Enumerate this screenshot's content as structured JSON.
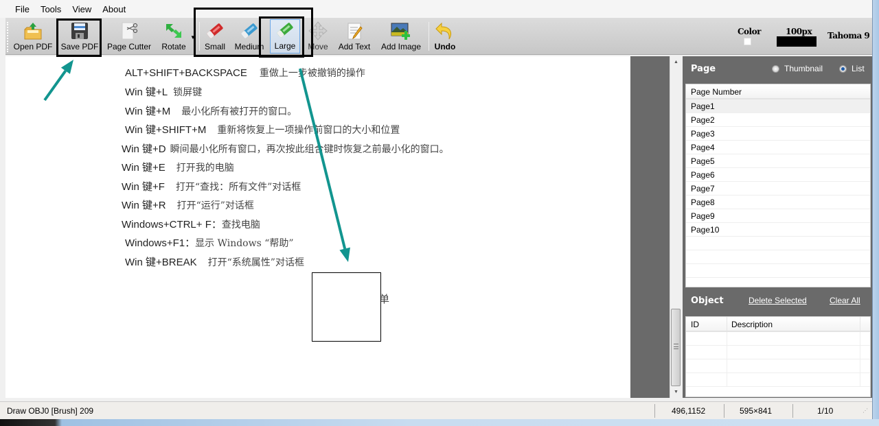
{
  "menu": [
    "File",
    "Tools",
    "View",
    "About"
  ],
  "toolbar": {
    "open_pdf": "Open PDF",
    "save_pdf": "Save PDF",
    "page_cutter": "Page Cutter",
    "rotate": "Rotate",
    "small": "Small",
    "medium": "Medium",
    "large": "Large",
    "move": "Move",
    "add_text": "Add Text",
    "add_image": "Add Image",
    "undo": "Undo",
    "color_label": "Color",
    "color_value": "#ffffff",
    "brush_size_label": "100px",
    "font_label": "Tahoma 9",
    "active_tool": "Large"
  },
  "document": {
    "lines": [
      {
        "key": "ALT+SHIFT+BACKSPACE",
        "desc": "重做上一步被撤销的操作"
      },
      {
        "key": "Win 键+L",
        "desc": "锁屏键"
      },
      {
        "key": "Win 键+M",
        "desc": "最小化所有被打开的窗口。"
      },
      {
        "key": "Win 键+SHIFT+M",
        "desc": "重新将恢复上一项操作前窗口的大小和位置"
      },
      {
        "key": "Win 键+D",
        "desc": "瞬间最小化所有窗口，再次按此组合键时恢复之前最小化的窗口。"
      },
      {
        "key": "Win 键+E",
        "desc": "打开我的电脑"
      },
      {
        "key": "Win 键+F",
        "desc": "打开“查找：所有文件”对话框"
      },
      {
        "key": "Win 键+R",
        "desc": "打开“运行”对话框"
      },
      {
        "key": "Windows+CTRL+ F：",
        "desc": "查找电脑"
      },
      {
        "key": "Windows+F1：",
        "desc": "显示  Windows “帮助”"
      },
      {
        "key": "Win 键+BREAK",
        "desc": "打开“系统属性”对话框"
      }
    ],
    "partial_text": "菜单"
  },
  "page_panel": {
    "title": "Page",
    "view_options": [
      "Thumbnail",
      "List"
    ],
    "selected_view": "List",
    "column_header": "Page Number",
    "pages": [
      "Page1",
      "Page2",
      "Page3",
      "Page4",
      "Page5",
      "Page6",
      "Page7",
      "Page8",
      "Page9",
      "Page10"
    ],
    "selected_page": "Page1"
  },
  "object_panel": {
    "title": "Object",
    "delete_selected": "Delete Selected",
    "clear_all": "Clear All",
    "columns": [
      "ID",
      "Description"
    ],
    "rows": []
  },
  "statusbar": {
    "message": "Draw OBJ0 [Brush] 209",
    "coords": "496,1152",
    "page_size": "595×841",
    "page_index": "1/10"
  },
  "annotation_color": "#12958f"
}
